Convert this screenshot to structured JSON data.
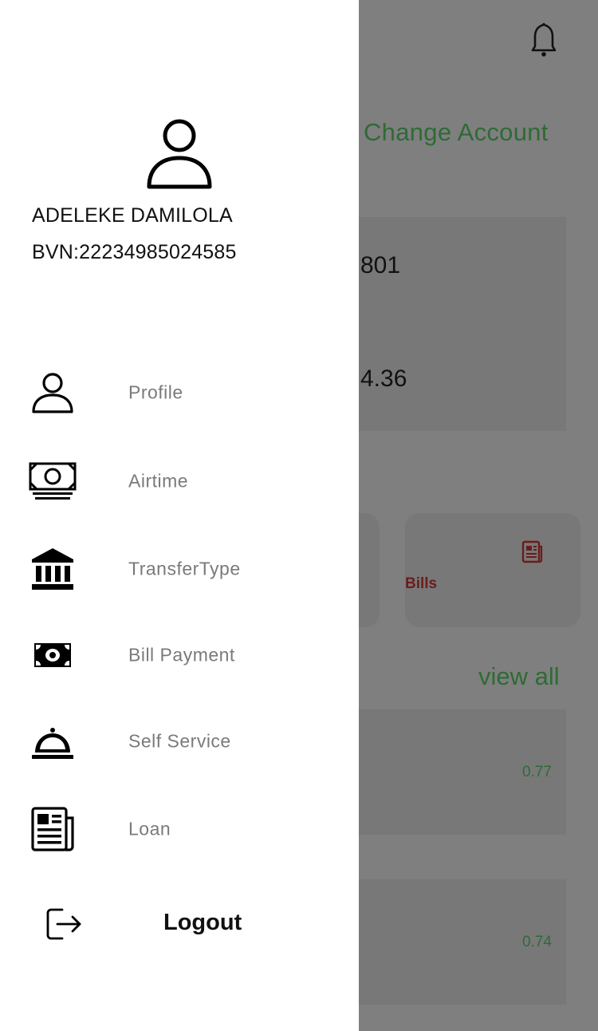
{
  "background": {
    "change_account": "Change Account",
    "account_number_fragment": "801",
    "balance_fragment": "4.36",
    "bills_label": "Bills",
    "view_all": "view all",
    "transactions": [
      {
        "amount": "0.77"
      },
      {
        "amount": "0.74"
      }
    ]
  },
  "drawer": {
    "user": {
      "name": "ADELEKE DAMILOLA",
      "bvn": "BVN:22234985024585"
    },
    "menu": [
      {
        "label": "Profile",
        "icon": "person-icon"
      },
      {
        "label": "Airtime",
        "icon": "money-icon"
      },
      {
        "label": "TransferType",
        "icon": "bank-icon"
      },
      {
        "label": "Bill Payment",
        "icon": "money-bill-icon"
      },
      {
        "label": "Self Service",
        "icon": "concierge-bell-icon"
      },
      {
        "label": "Loan",
        "icon": "newspaper-icon"
      }
    ],
    "logout_label": "Logout"
  },
  "colors": {
    "accent_green": "#2e6b35",
    "bills_red": "#6b1c1c",
    "overlay_gray": "#7f7f7f"
  }
}
